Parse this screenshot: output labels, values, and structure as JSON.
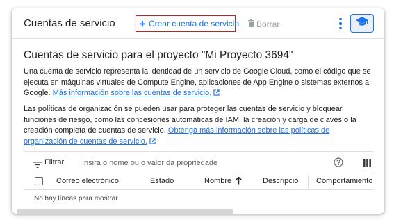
{
  "toolbar": {
    "title": "Cuentas de servicio",
    "create_label": "Crear cuenta de servicio",
    "delete_label": "Borrar"
  },
  "heading": "Cuentas de servicio para el proyecto \"Mi Proyecto 3694\"",
  "intro": {
    "text": "Una cuenta de servicio representa la identidad de un servicio de Google Cloud, como el código que se ejecuta en máquinas virtuales de Compute Engine, aplicaciones de App Engine o sistemas externos a Google. ",
    "link": "Más información sobre las cuentas de servicio."
  },
  "policies": {
    "text": "Las políticas de organización se pueden usar para proteger las cuentas de servicio y bloquear funciones de riesgo, como las concesiones automáticas de IAM, la creación y carga de claves o la creación completa de cuentas de servicio. ",
    "link": "Obtenga más información sobre las políticas de organización de cuentas de servicio."
  },
  "filter": {
    "label": "Filtrar",
    "placeholder": "Insira o nome ou o valor da propriedade"
  },
  "table": {
    "columns": [
      "Correo electrónico",
      "Estado",
      "Nombre",
      "Descripció",
      "Comportamiento"
    ],
    "empty_message": "No hay líneas para mostrar"
  },
  "icons": {
    "create": "plus-icon",
    "delete": "trash-icon",
    "more": "more-vert-icon",
    "learn": "school-icon",
    "external": "open-in-new-icon",
    "filter": "filter-list-icon",
    "help": "help-icon",
    "columns": "column-display-icon",
    "sort": "arrow-upward-icon"
  },
  "colors": {
    "accent": "#1a73e8",
    "highlight_border": "#c5221f",
    "disabled": "#9aa0a6",
    "learn_bg": "#e8f0fe"
  }
}
